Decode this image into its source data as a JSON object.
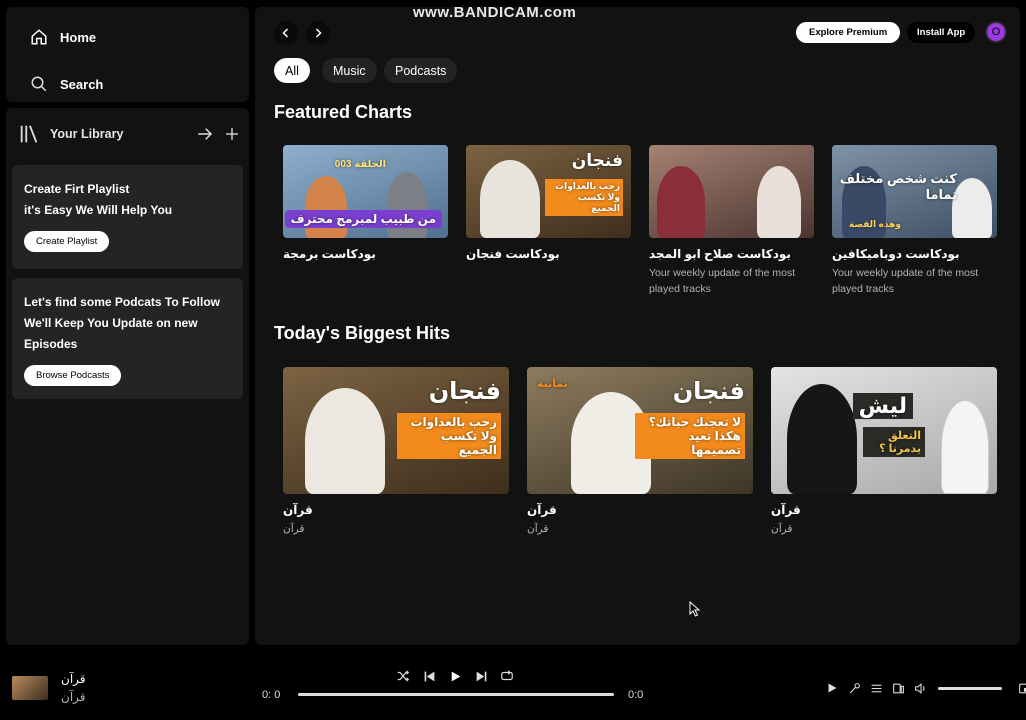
{
  "watermark": "www.BANDICAM.com",
  "nav": {
    "home": "Home",
    "search": "Search"
  },
  "library": {
    "title": "Your Library",
    "playlist_card": {
      "line1": "Create Firt Playlist",
      "line2": "it's Easy We Will Help You",
      "button": "Create Playlist"
    },
    "podcast_card": {
      "line1": "Let's find some Podcats To Follow",
      "line2": "We'll Keep You Update on new",
      "line3": "Episodes",
      "button": "Browse Podcasts"
    }
  },
  "header": {
    "explore_premium": "Explore Premium",
    "install_app": "Install App",
    "avatar_letter": "O"
  },
  "filters": [
    "All",
    "Music",
    "Podcasts"
  ],
  "featured": {
    "title": "Featured Charts",
    "items": [
      {
        "title": "بودكاست برمجة",
        "subtitle": "",
        "overlay": "من طبيب لمبرمج محترف",
        "overlay2": "الحلقة 003",
        "bg": "#6d8fae"
      },
      {
        "title": "بودكاست فنجان",
        "subtitle": "",
        "overlay": "فنجان",
        "overlay2": "رحب بالعداوات ولا تكسب الجميع",
        "bg": "#6b5537"
      },
      {
        "title": "بودكاست صلاح ابو المجد",
        "subtitle": "Your weekly update of the most played tracks",
        "overlay": "",
        "overlay2": "",
        "bg": "#7a5b52"
      },
      {
        "title": "بودكاست دوباميكافين",
        "subtitle": "Your weekly update of the most played tracks",
        "overlay": "كنت شخص مختلف تماما",
        "overlay2": "وهذه القصة",
        "bg": "#5a6f82"
      }
    ]
  },
  "hits": {
    "title": "Today's Biggest Hits",
    "items": [
      {
        "title": "قرآن",
        "subtitle": "قرآن",
        "overlay": "فنجان",
        "overlay2": "رحب بالعداوات ولا تكسب الجميع",
        "bg": "#6b5537"
      },
      {
        "title": "قرآن",
        "subtitle": "قرآن",
        "overlay": "فنجان",
        "overlay2": "لا تعجبك حياتك؟ هكذا تعيد تصميمها",
        "tag": "ثمانية",
        "bg": "#7b6a4f"
      },
      {
        "title": "قرآن",
        "subtitle": "قرآن",
        "overlay": "ليش",
        "overlay2": "التعلق يدمرنا ؟",
        "bg": "#c9c9c9"
      }
    ]
  },
  "player": {
    "track_title": "قرآن",
    "track_artist": "قرآن",
    "time_elapsed": "0: 0",
    "time_total": "0:0"
  },
  "colors": {
    "accent": "#9b3ae0",
    "chip_active": "#ffffff",
    "chip_bg": "#232323",
    "orange": "#f28b1c"
  }
}
